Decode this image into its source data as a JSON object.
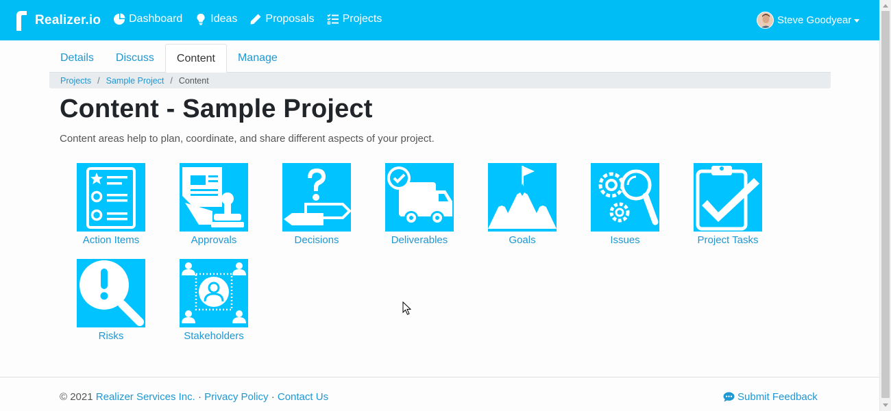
{
  "navbar": {
    "brand": "Realizer.io",
    "links": [
      {
        "label": "Dashboard",
        "icon": "pie-chart-icon"
      },
      {
        "label": "Ideas",
        "icon": "lightbulb-icon"
      },
      {
        "label": "Proposals",
        "icon": "pencil-icon"
      },
      {
        "label": "Projects",
        "icon": "list-check-icon"
      }
    ],
    "user_name": "Steve Goodyear",
    "bg_color": "#00bdf6"
  },
  "tabs": [
    {
      "label": "Details",
      "active": false
    },
    {
      "label": "Discuss",
      "active": false
    },
    {
      "label": "Content",
      "active": true
    },
    {
      "label": "Manage",
      "active": false
    }
  ],
  "breadcrumb": {
    "items": [
      "Projects",
      "Sample Project"
    ],
    "separator": "/",
    "current": "Content"
  },
  "page": {
    "title": "Content - Sample Project",
    "lead": "Content areas help to plan, coordinate, and share different aspects of your project."
  },
  "tiles": [
    {
      "label": "Action Items",
      "icon": "action-items-icon"
    },
    {
      "label": "Approvals",
      "icon": "approvals-icon"
    },
    {
      "label": "Decisions",
      "icon": "decisions-icon"
    },
    {
      "label": "Deliverables",
      "icon": "deliverables-icon"
    },
    {
      "label": "Goals",
      "icon": "goals-icon"
    },
    {
      "label": "Issues",
      "icon": "issues-icon"
    },
    {
      "label": "Project Tasks",
      "icon": "project-tasks-icon"
    },
    {
      "label": "Risks",
      "icon": "risks-icon"
    },
    {
      "label": "Stakeholders",
      "icon": "stakeholders-icon"
    }
  ],
  "footer": {
    "copyright": "© 2021",
    "company": "Realizer Services Inc.",
    "dot": "·",
    "privacy": "Privacy Policy",
    "contact": "Contact Us",
    "feedback": "Submit Feedback"
  },
  "colors": {
    "accent": "#00bdf6",
    "tile": "#00c3ff",
    "link": "#1e97d3"
  }
}
